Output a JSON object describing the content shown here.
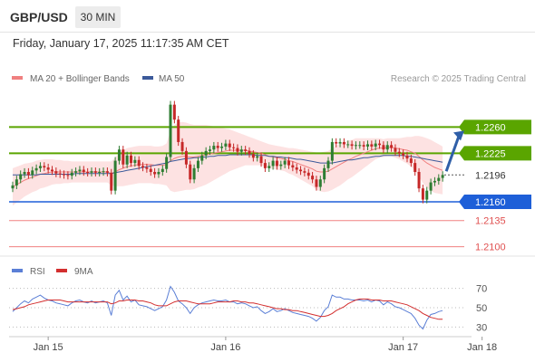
{
  "header": {
    "symbol": "GBP/USD",
    "timeframe": "30 MIN",
    "datetime": "Friday, January 17, 2025 11:17:35 AM CET"
  },
  "colors": {
    "ma20": "#f08080",
    "bollinger_fill": "#fde2e2",
    "ma50": "#3c5a9a",
    "resistance": "#5aa500",
    "support": "#1e5fd8",
    "minor_level": "#f08080",
    "candle_up": "#2e7d32",
    "candle_down": "#c62828",
    "rsi": "#5b7fd6",
    "rsi_ma": "#d32f2f",
    "arrow": "#2f5fa8"
  },
  "chart_data": [
    {
      "type": "candlestick",
      "legend": [
        {
          "name": "MA 20 + Bollinger Bands",
          "color": "#f08080"
        },
        {
          "name": "MA 50",
          "color": "#3c5a9a"
        }
      ],
      "attribution": "Research © 2025 Trading Central",
      "ylim": [
        1.2085,
        1.2315
      ],
      "x_ticks": [
        {
          "label": "Jan 15",
          "index": 9
        },
        {
          "label": "Jan 16",
          "index": 54
        },
        {
          "label": "Jan 17",
          "index": 99
        },
        {
          "label": "Jan 18",
          "index": 119
        }
      ],
      "levels": [
        {
          "value": 1.226,
          "label": "1.2260",
          "kind": "resistance"
        },
        {
          "value": 1.2225,
          "label": "1.2225",
          "kind": "resistance"
        },
        {
          "value": 1.2196,
          "label": "1.2196",
          "kind": "current"
        },
        {
          "value": 1.216,
          "label": "1.2160",
          "kind": "support"
        },
        {
          "value": 1.2135,
          "label": "1.2135",
          "kind": "minor"
        },
        {
          "value": 1.21,
          "label": "1.2100",
          "kind": "minor"
        }
      ],
      "close": [
        1.2182,
        1.219,
        1.2197,
        1.22,
        1.2196,
        1.2202,
        1.2205,
        1.2208,
        1.2206,
        1.2203,
        1.2201,
        1.2198,
        1.2197,
        1.2196,
        1.2195,
        1.2199,
        1.2201,
        1.2203,
        1.22,
        1.2199,
        1.2201,
        1.2199,
        1.22,
        1.2201,
        1.2199,
        1.2175,
        1.2215,
        1.223,
        1.221,
        1.2222,
        1.2212,
        1.2216,
        1.2208,
        1.2206,
        1.2204,
        1.22,
        1.2197,
        1.22,
        1.2204,
        1.222,
        1.229,
        1.227,
        1.224,
        1.2228,
        1.221,
        1.219,
        1.2205,
        1.2215,
        1.2222,
        1.2228,
        1.223,
        1.2235,
        1.2232,
        1.2234,
        1.2238,
        1.2233,
        1.2232,
        1.2227,
        1.223,
        1.2228,
        1.2224,
        1.2219,
        1.2221,
        1.2212,
        1.2205,
        1.2208,
        1.2215,
        1.2208,
        1.221,
        1.2215,
        1.2209,
        1.2206,
        1.2203,
        1.2201,
        1.2199,
        1.2195,
        1.219,
        1.218,
        1.219,
        1.2205,
        1.2215,
        1.224,
        1.2238,
        1.224,
        1.2237,
        1.2237,
        1.2235,
        1.2236,
        1.2236,
        1.2234,
        1.2237,
        1.2234,
        1.2238,
        1.2236,
        1.223,
        1.2236,
        1.2232,
        1.2227,
        1.2225,
        1.2222,
        1.2218,
        1.2212,
        1.22,
        1.2178,
        1.2163,
        1.2175,
        1.2186,
        1.2188,
        1.2192,
        1.2196
      ],
      "ma20": [
        1.218,
        1.2183,
        1.2186,
        1.2189,
        1.2191,
        1.2193,
        1.2195,
        1.2197,
        1.2198,
        1.2199,
        1.22,
        1.22,
        1.22,
        1.22,
        1.22,
        1.22,
        1.22,
        1.22,
        1.22,
        1.22,
        1.22,
        1.22,
        1.22,
        1.22,
        1.22,
        1.2198,
        1.22,
        1.2203,
        1.2205,
        1.2207,
        1.2208,
        1.2209,
        1.221,
        1.221,
        1.221,
        1.221,
        1.2209,
        1.2209,
        1.2209,
        1.221,
        1.2215,
        1.2218,
        1.222,
        1.2221,
        1.2221,
        1.222,
        1.222,
        1.2221,
        1.2222,
        1.2223,
        1.2224,
        1.2225,
        1.2226,
        1.2227,
        1.2228,
        1.2229,
        1.2229,
        1.2229,
        1.2229,
        1.2229,
        1.2228,
        1.2227,
        1.2226,
        1.2225,
        1.2223,
        1.2221,
        1.222,
        1.2219,
        1.2218,
        1.2217,
        1.2215,
        1.2214,
        1.2212,
        1.221,
        1.2208,
        1.2206,
        1.2204,
        1.2201,
        1.22,
        1.22,
        1.2201,
        1.2204,
        1.2207,
        1.221,
        1.2213,
        1.2216,
        1.2218,
        1.2221,
        1.2223,
        1.2225,
        1.2227,
        1.2229,
        1.2231,
        1.2232,
        1.2232,
        1.2233,
        1.2233,
        1.2232,
        1.2231,
        1.223,
        1.2229,
        1.2227,
        1.2225,
        1.2221,
        1.2216,
        1.2212,
        1.2209,
        1.2206,
        1.2204,
        1.2202
      ],
      "ma50": [
        1.2196,
        1.2196,
        1.2196,
        1.2196,
        1.2196,
        1.2196,
        1.2196,
        1.2197,
        1.2197,
        1.2197,
        1.2197,
        1.2197,
        1.2197,
        1.2197,
        1.2197,
        1.2197,
        1.2198,
        1.2198,
        1.2198,
        1.2198,
        1.2198,
        1.2198,
        1.2198,
        1.2198,
        1.2198,
        1.2198,
        1.2199,
        1.22,
        1.2201,
        1.2202,
        1.2203,
        1.2204,
        1.2205,
        1.2206,
        1.2207,
        1.2208,
        1.2209,
        1.221,
        1.2211,
        1.2212,
        1.2214,
        1.2215,
        1.2216,
        1.2217,
        1.2218,
        1.2218,
        1.2219,
        1.2219,
        1.222,
        1.222,
        1.2221,
        1.2221,
        1.2222,
        1.2222,
        1.2222,
        1.2223,
        1.2223,
        1.2223,
        1.2223,
        1.2223,
        1.2223,
        1.2223,
        1.2222,
        1.2222,
        1.2222,
        1.2221,
        1.2221,
        1.222,
        1.222,
        1.2219,
        1.2219,
        1.2218,
        1.2217,
        1.2217,
        1.2216,
        1.2215,
        1.2214,
        1.2213,
        1.2212,
        1.2212,
        1.2212,
        1.2212,
        1.2213,
        1.2214,
        1.2215,
        1.2216,
        1.2216,
        1.2217,
        1.2218,
        1.2219,
        1.2219,
        1.222,
        1.2221,
        1.2221,
        1.2222,
        1.2222,
        1.2222,
        1.2222,
        1.2222,
        1.2222,
        1.2221,
        1.2221,
        1.222,
        1.2219,
        1.2218,
        1.2217,
        1.2216,
        1.2215,
        1.2214,
        1.2213
      ],
      "band_halfwidth": [
        0.0025,
        0.0024,
        0.0023,
        0.0022,
        0.0021,
        0.002,
        0.002,
        0.0019,
        0.0019,
        0.0018,
        0.0017,
        0.0016,
        0.0016,
        0.0015,
        0.0015,
        0.0014,
        0.0014,
        0.0014,
        0.0014,
        0.0014,
        0.0014,
        0.0014,
        0.0014,
        0.0014,
        0.0014,
        0.0016,
        0.0019,
        0.0022,
        0.0024,
        0.0025,
        0.0025,
        0.0025,
        0.0025,
        0.0025,
        0.0025,
        0.0025,
        0.0025,
        0.0025,
        0.0026,
        0.0028,
        0.004,
        0.0045,
        0.0046,
        0.0046,
        0.0045,
        0.0044,
        0.0043,
        0.0042,
        0.0041,
        0.004,
        0.0038,
        0.0036,
        0.0034,
        0.0032,
        0.003,
        0.0028,
        0.0026,
        0.0024,
        0.0022,
        0.002,
        0.0019,
        0.0018,
        0.0017,
        0.0016,
        0.0016,
        0.0016,
        0.0016,
        0.0016,
        0.0016,
        0.0016,
        0.0017,
        0.0018,
        0.0019,
        0.002,
        0.0021,
        0.0022,
        0.0023,
        0.0025,
        0.0026,
        0.0027,
        0.0027,
        0.0028,
        0.0028,
        0.0028,
        0.0027,
        0.0026,
        0.0025,
        0.0024,
        0.0022,
        0.002,
        0.0018,
        0.0016,
        0.0014,
        0.0013,
        0.0012,
        0.0012,
        0.0012,
        0.0013,
        0.0014,
        0.0016,
        0.0018,
        0.002,
        0.0023,
        0.0027,
        0.0031,
        0.0033,
        0.0034,
        0.0034,
        0.0033,
        0.0032
      ]
    },
    {
      "type": "line",
      "title": "RSI",
      "legend": [
        {
          "name": "RSI",
          "color": "#5b7fd6"
        },
        {
          "name": "9MA",
          "color": "#d32f2f"
        }
      ],
      "ylim": [
        20,
        80
      ],
      "y_ticks": [
        70,
        50,
        30
      ],
      "rsi": [
        46,
        50,
        54,
        57,
        55,
        59,
        61,
        63,
        60,
        58,
        57,
        55,
        54,
        53,
        52,
        55,
        57,
        58,
        56,
        55,
        57,
        55,
        56,
        57,
        55,
        42,
        63,
        68,
        58,
        62,
        56,
        58,
        53,
        52,
        51,
        49,
        47,
        49,
        51,
        58,
        72,
        66,
        57,
        54,
        50,
        44,
        50,
        53,
        55,
        56,
        57,
        58,
        57,
        57,
        58,
        56,
        56,
        54,
        55,
        54,
        52,
        50,
        51,
        47,
        44,
        46,
        49,
        46,
        47,
        49,
        47,
        45,
        44,
        43,
        42,
        41,
        39,
        36,
        40,
        47,
        51,
        63,
        61,
        61,
        59,
        59,
        58,
        58,
        58,
        57,
        58,
        56,
        58,
        57,
        53,
        56,
        54,
        51,
        50,
        48,
        46,
        44,
        39,
        32,
        28,
        37,
        43,
        44,
        46,
        47
      ],
      "rsi_ma": [
        48,
        49,
        50,
        51,
        53,
        54,
        55,
        56,
        57,
        58,
        58,
        58,
        58,
        57,
        56,
        56,
        56,
        56,
        56,
        56,
        56,
        56,
        56,
        56,
        56,
        54,
        55,
        57,
        57,
        58,
        58,
        58,
        57,
        57,
        56,
        55,
        53,
        52,
        52,
        52,
        54,
        56,
        57,
        57,
        57,
        56,
        55,
        54,
        54,
        54,
        54,
        55,
        56,
        56,
        56,
        56,
        57,
        57,
        56,
        56,
        55,
        55,
        54,
        53,
        52,
        51,
        50,
        49,
        49,
        48,
        48,
        47,
        47,
        46,
        45,
        44,
        43,
        42,
        41,
        41,
        42,
        44,
        47,
        49,
        51,
        54,
        56,
        58,
        59,
        59,
        59,
        58,
        58,
        58,
        57,
        57,
        57,
        56,
        55,
        54,
        53,
        51,
        49,
        47,
        44,
        42,
        40,
        39,
        38,
        38
      ]
    }
  ],
  "rsi_panel": {
    "ticks": [
      "70",
      "50",
      "30"
    ]
  },
  "x_axis": {
    "labels": [
      "Jan 15",
      "Jan 16",
      "Jan 17",
      "Jan 18"
    ]
  }
}
